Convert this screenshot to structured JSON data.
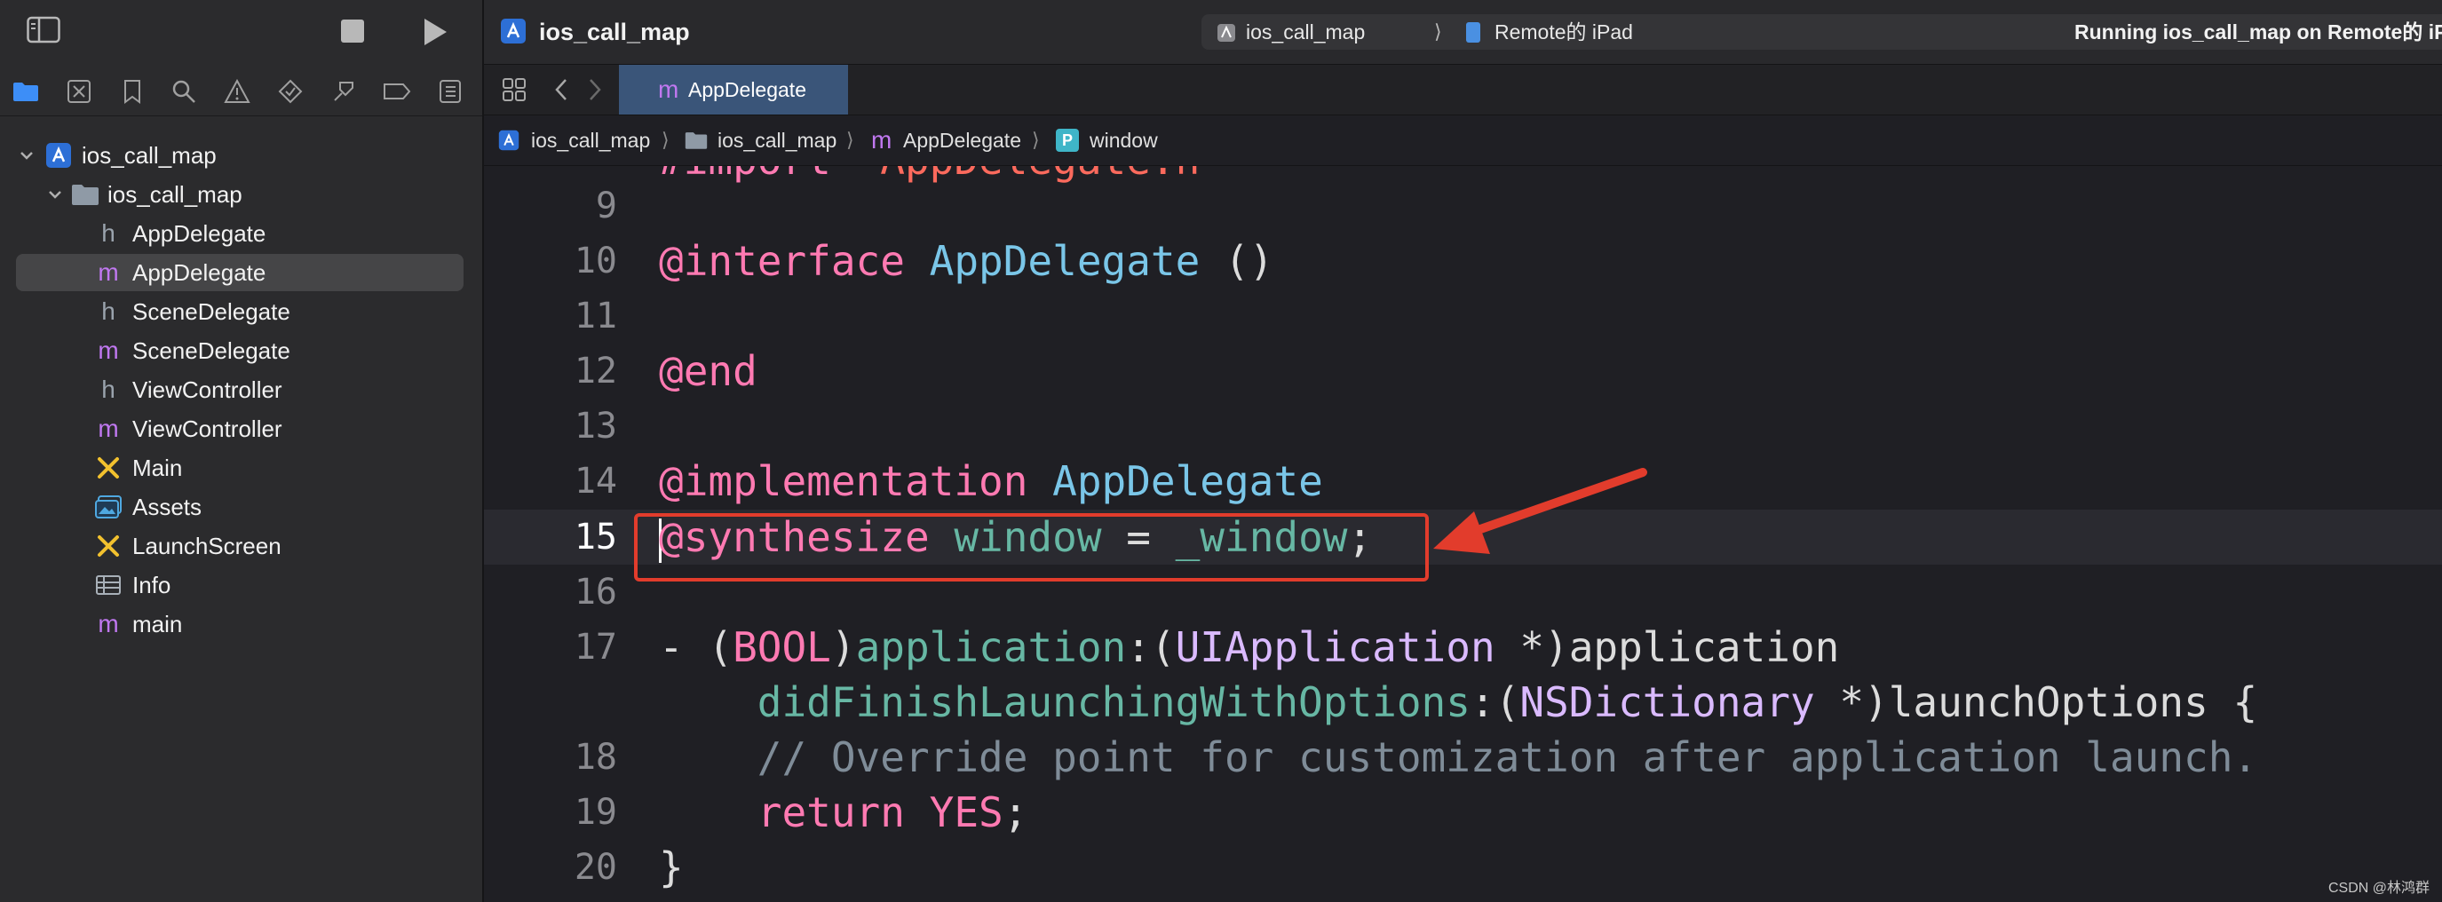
{
  "project": {
    "name": "ios_call_map",
    "tree": [
      {
        "label": "ios_call_map",
        "kind": "project",
        "icon": "xcode-project-icon"
      },
      {
        "label": "ios_call_map",
        "kind": "folder",
        "icon": "folder-icon"
      },
      {
        "label": "AppDelegate",
        "kind": "h",
        "badge": "h"
      },
      {
        "label": "AppDelegate",
        "kind": "m",
        "badge": "m",
        "selected": true
      },
      {
        "label": "SceneDelegate",
        "kind": "h",
        "badge": "h"
      },
      {
        "label": "SceneDelegate",
        "kind": "m",
        "badge": "m"
      },
      {
        "label": "ViewController",
        "kind": "h",
        "badge": "h"
      },
      {
        "label": "ViewController",
        "kind": "m",
        "badge": "m"
      },
      {
        "label": "Main",
        "kind": "storyboard",
        "icon": "storyboard-icon"
      },
      {
        "label": "Assets",
        "kind": "assets",
        "icon": "assets-icon"
      },
      {
        "label": "LaunchScreen",
        "kind": "storyboard",
        "icon": "storyboard-icon"
      },
      {
        "label": "Info",
        "kind": "plist",
        "icon": "plist-icon"
      },
      {
        "label": "main",
        "kind": "m",
        "badge": "m"
      }
    ]
  },
  "toolbar": {
    "title": "ios_call_map",
    "scheme": "ios_call_map",
    "device": "Remote的 iPad",
    "status": "Running ios_call_map on Remote的 iPad"
  },
  "tab": {
    "badge": "m",
    "label": "AppDelegate"
  },
  "jumpbar": {
    "items": [
      "ios_call_map",
      "ios_call_map",
      "AppDelegate",
      "window"
    ],
    "badges": [
      "",
      "",
      "m",
      "P"
    ]
  },
  "editor": {
    "line_numbers": [
      "9",
      "10",
      "11",
      "12",
      "13",
      "14",
      "15",
      "16",
      "17",
      "",
      "18",
      "19",
      "20"
    ],
    "current_line": "15"
  },
  "watermark": "CSDN @林鸿群",
  "colors": {
    "keyword": "#ff7ab2",
    "type": "#7ac6e8",
    "comment": "#7f8c98",
    "highlight_box": "#e23c2c"
  }
}
